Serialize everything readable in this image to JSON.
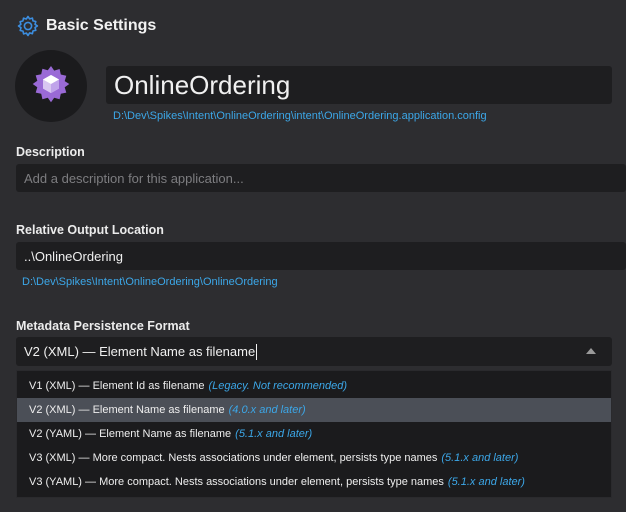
{
  "header": {
    "title": "Basic Settings",
    "icon": "gear-icon"
  },
  "application": {
    "name": "OnlineOrdering",
    "config_path": "D:\\Dev\\Spikes\\Intent\\OnlineOrdering\\intent\\OnlineOrdering.application.config",
    "logo_icon": "cube-gear-icon"
  },
  "description": {
    "label": "Description",
    "value": "",
    "placeholder": "Add a description for this application..."
  },
  "output": {
    "label": "Relative Output Location",
    "value": "..\\OnlineOrdering",
    "resolved_path": "D:\\Dev\\Spikes\\Intent\\OnlineOrdering\\OnlineOrdering"
  },
  "persistence": {
    "label": "Metadata Persistence Format",
    "selected": "V2 (XML) — Element Name as filename",
    "options": [
      {
        "label": "V1 (XML) — Element Id as filename",
        "note": "(Legacy. Not recommended)"
      },
      {
        "label": "V2 (XML) — Element Name as filename",
        "note": "(4.0.x and later)"
      },
      {
        "label": "V2 (YAML) — Element Name as filename",
        "note": "(5.1.x and later)"
      },
      {
        "label": "V3 (XML) — More compact. Nests associations under element, persists type names",
        "note": "(5.1.x and later)"
      },
      {
        "label": "V3 (YAML) — More compact. Nests associations under element, persists type names",
        "note": "(5.1.x and later)"
      }
    ]
  },
  "colors": {
    "accent": "#3ca7e8",
    "logo": "#9a6ad6",
    "background": "#2d2d30",
    "field": "#1e1e20"
  }
}
